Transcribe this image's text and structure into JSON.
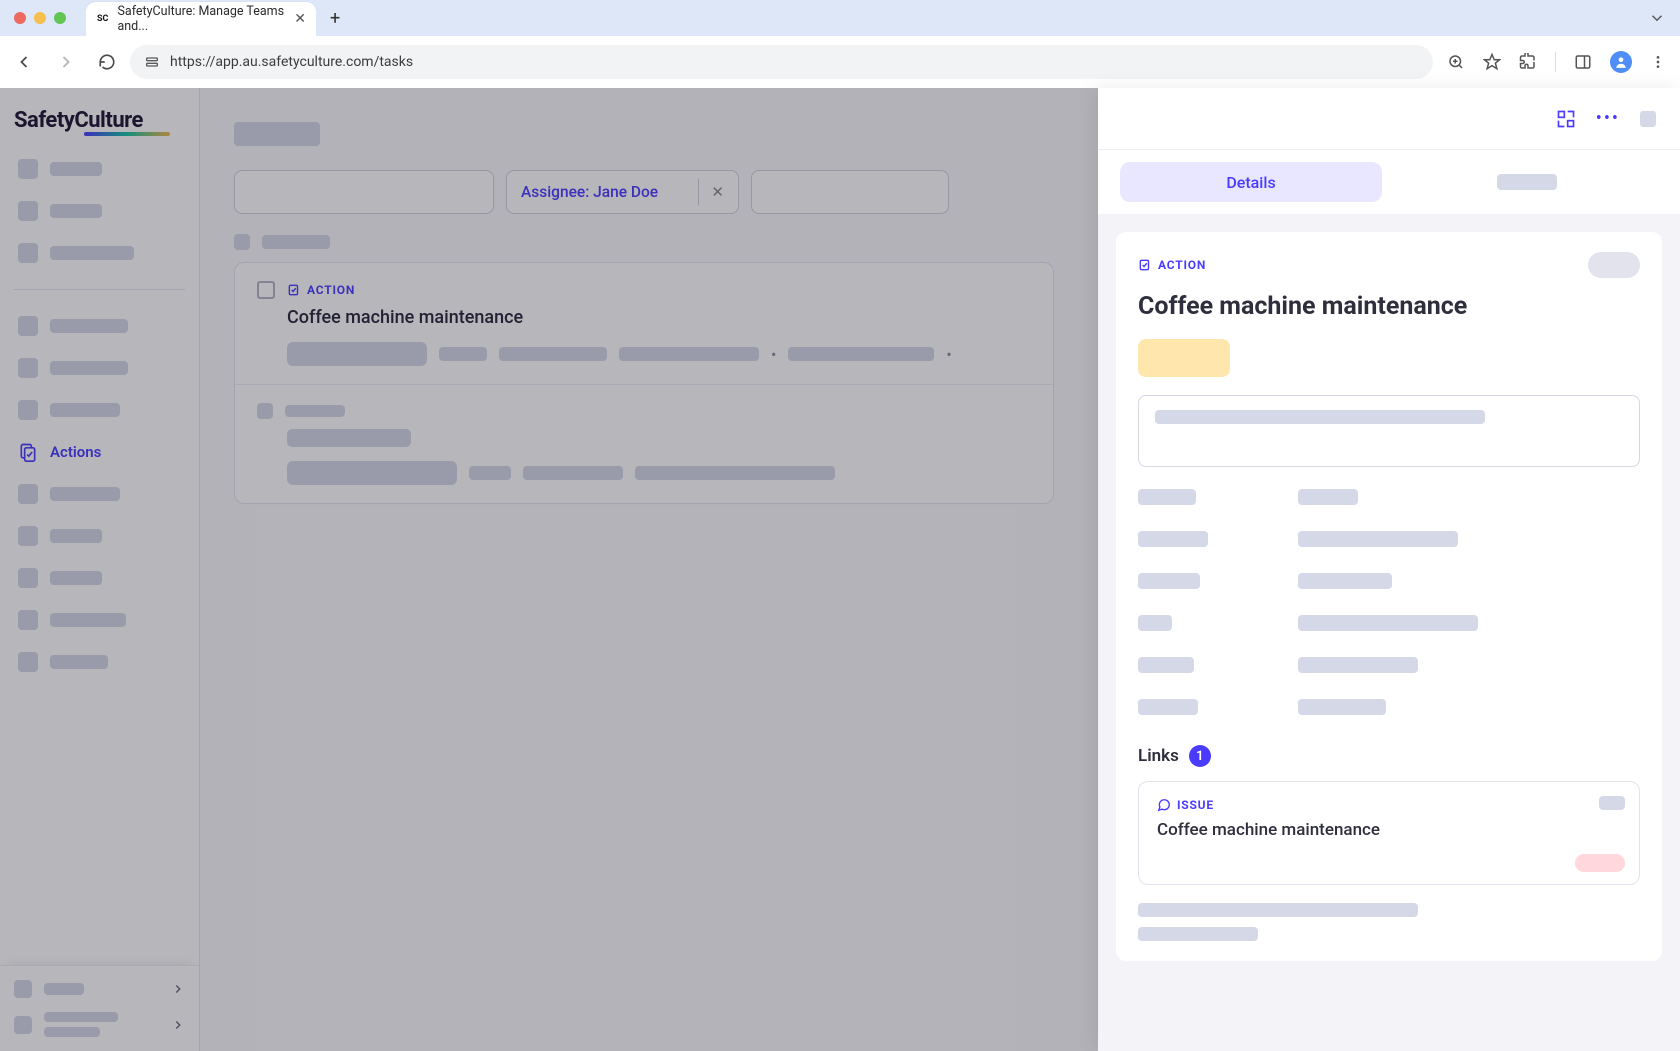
{
  "browser": {
    "tab_title": "SafetyCulture: Manage Teams and...",
    "url": "https://app.au.safetyculture.com/tasks"
  },
  "sidebar": {
    "brand": "SafetyCulture",
    "active_item": "Actions"
  },
  "filters": {
    "assignee_chip": "Assignee: Jane Doe"
  },
  "list": {
    "action_label": "ACTION",
    "row1_title": "Coffee machine maintenance"
  },
  "panel": {
    "tabs": {
      "details": "Details"
    },
    "action_label": "ACTION",
    "title": "Coffee machine maintenance",
    "links": {
      "header": "Links",
      "count": "1",
      "issue_label": "ISSUE",
      "link_title": "Coffee machine maintenance"
    }
  }
}
